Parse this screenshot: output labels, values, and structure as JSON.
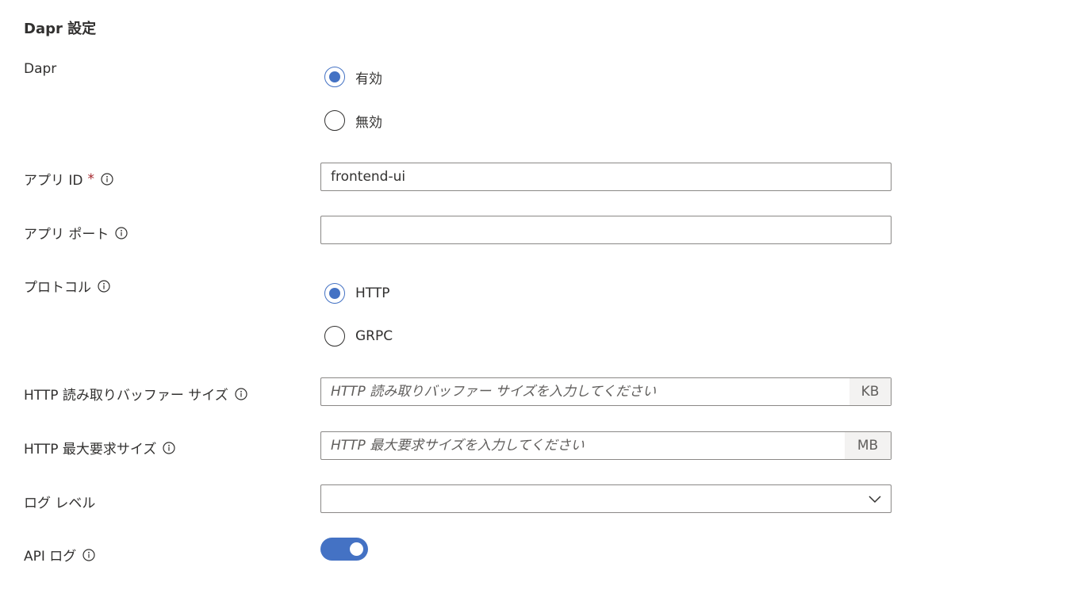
{
  "section": {
    "title": "Dapr 設定"
  },
  "dapr": {
    "label": "Dapr",
    "options": [
      "有効",
      "無効"
    ],
    "selected": "有効"
  },
  "app_id": {
    "label": "アプリ ID",
    "required_mark": "*",
    "value": "frontend-ui"
  },
  "app_port": {
    "label": "アプリ ポート",
    "value": ""
  },
  "protocol": {
    "label": "プロトコル",
    "options": [
      "HTTP",
      "GRPC"
    ],
    "selected": "HTTP"
  },
  "http_read_buffer": {
    "label": "HTTP 読み取りバッファー サイズ",
    "placeholder": "HTTP 読み取りバッファー サイズを入力してください",
    "unit": "KB"
  },
  "http_max_request": {
    "label": "HTTP 最大要求サイズ",
    "placeholder": "HTTP 最大要求サイズを入力してください",
    "unit": "MB"
  },
  "log_level": {
    "label": "ログ レベル",
    "value": ""
  },
  "api_log": {
    "label": "API ログ",
    "enabled": true
  },
  "icons": {
    "info": "info-icon",
    "dropdown": "chevron-down-icon"
  },
  "colors": {
    "accent": "#4472c4",
    "required": "#a4262c",
    "text": "#323130",
    "border": "#8a8886",
    "suffix_bg": "#f3f2f1"
  }
}
